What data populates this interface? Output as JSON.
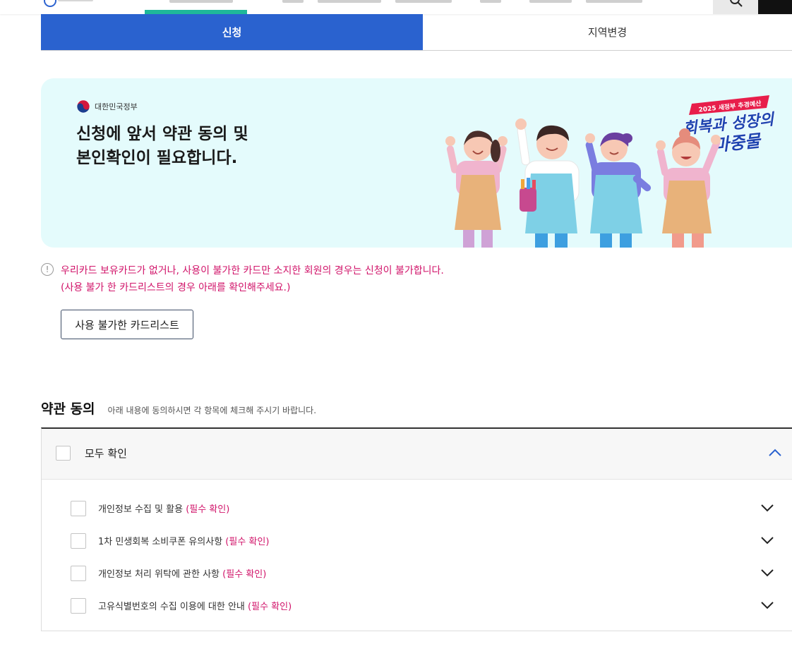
{
  "tabs": {
    "apply": "신청",
    "region_change": "지역변경"
  },
  "banner": {
    "gov_name": "대한민국정부",
    "title_line1": "신청에 앞서 약관 동의 및",
    "title_line2": "본인확인이 필요합니다.",
    "slogan_top": "2025 새정부 추경예산",
    "slogan_line1": "회복과 성장의",
    "slogan_line2": "마중물"
  },
  "notice": {
    "line1": "우리카드 보유카드가 없거나, 사용이 불가한 카드만 소지한 회원의 경우는 신청이 불가합니다.",
    "line2": "(사용 불가 한 카드리스트의 경우 아래를 확인해주세요.)",
    "button": "사용 불가한 카드리스트"
  },
  "terms": {
    "title": "약관 동의",
    "description": "아래 내용에 동의하시면 각 항목에 체크해 주시기 바랍니다.",
    "all_label": "모두 확인",
    "items": [
      {
        "label": "개인정보 수집 및 활용",
        "required": "(필수 확인)"
      },
      {
        "label": "1차 민생회복 소비쿠폰 유의사항",
        "required": "(필수 확인)"
      },
      {
        "label": "개인정보 처리 위탁에 관한 사항",
        "required": "(필수 확인)"
      },
      {
        "label": "고유식별번호의 수집 이용에 대한 안내",
        "required": "(필수 확인)"
      }
    ]
  },
  "colors": {
    "primary": "#2a62cf",
    "accent": "#d1146a",
    "banner_bg": "#e4fbfc"
  }
}
